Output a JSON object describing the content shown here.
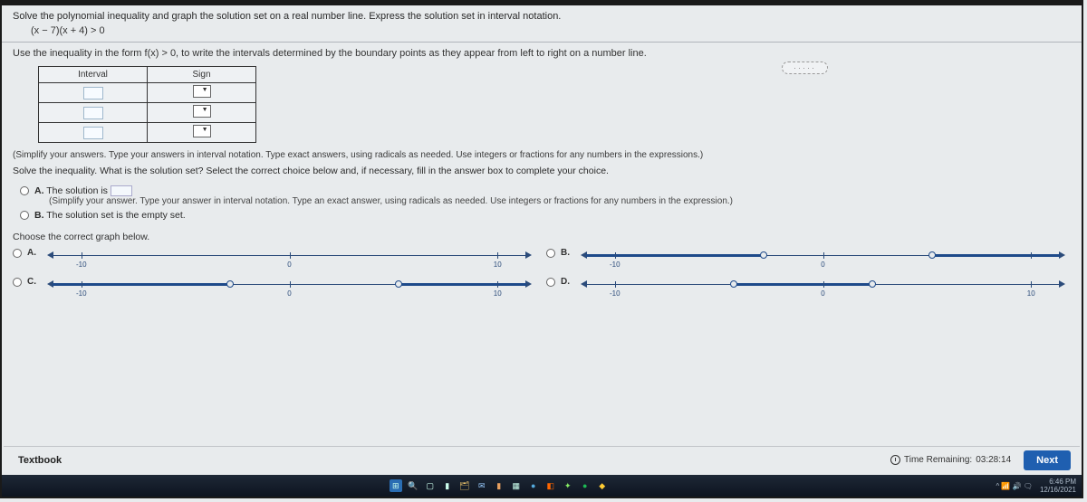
{
  "question": {
    "line1": "Solve the polynomial inequality and graph the solution set on a real number line. Express the solution set in interval notation.",
    "formula": "(x − 7)(x + 4) > 0"
  },
  "instruction2": "Use the inequality in the form f(x) > 0, to write the intervals determined by the boundary points as they appear from left to right on a number line.",
  "table": {
    "headers": [
      "Interval",
      "Sign"
    ]
  },
  "table_hint": "(Simplify your answers. Type your answers in interval notation. Type exact answers, using radicals as needed. Use integers or fractions for any numbers in the expressions.)",
  "solve_prompt": "Solve the inequality. What is the solution set? Select the correct choice below and, if necessary, fill in the answer box to complete your choice.",
  "choices": {
    "a_label": "A.",
    "a_text": "The solution is ",
    "a_hint": "(Simplify your answer. Type your answer in interval notation. Type an exact answer, using radicals as needed. Use integers or fractions for any numbers in the expression.)",
    "b_label": "B.",
    "b_text": "The solution set is the empty set."
  },
  "graph_prompt": "Choose the correct graph below.",
  "graph_labels": {
    "a": "A.",
    "b": "B.",
    "c": "C.",
    "d": "D."
  },
  "axis_ticks": {
    "neg": "-10",
    "zero": "0",
    "pos": "10"
  },
  "footer": {
    "textbook": "Textbook",
    "time_label": "Time Remaining:",
    "time_value": "03:28:14",
    "next": "Next"
  },
  "ellipsis": "·····",
  "taskbar": {
    "time": "6:46 PM",
    "date": "12/16/2021",
    "tray": "^  📶 🔊 🗨"
  }
}
